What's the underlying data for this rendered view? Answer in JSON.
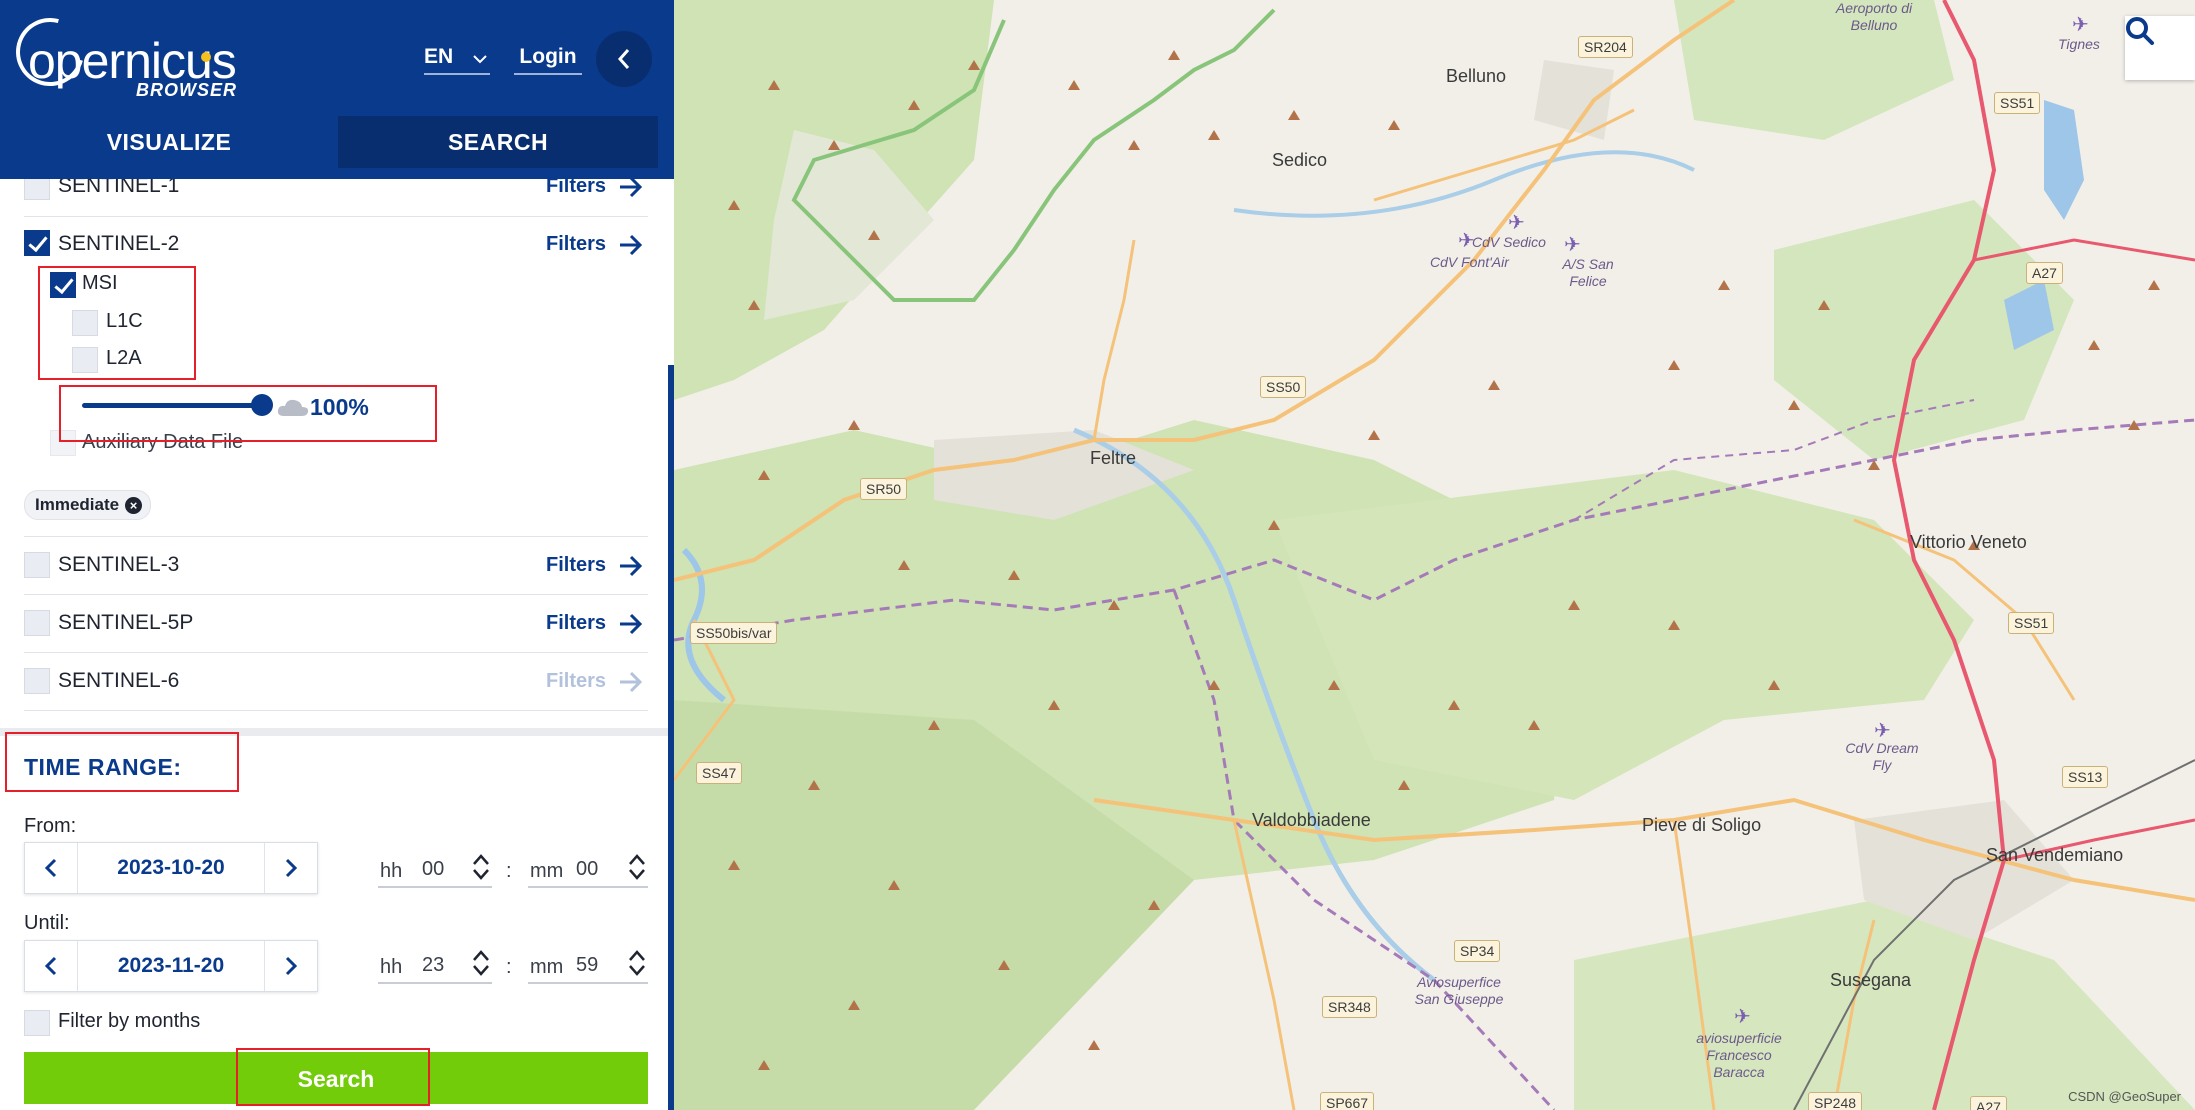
{
  "header": {
    "logo_text": "opernicus",
    "logo_subtext": "BROWSER",
    "language": "EN",
    "login_label": "Login",
    "tabs": [
      "VISUALIZE",
      "SEARCH"
    ],
    "active_tab": "SEARCH"
  },
  "datasets": {
    "filters_label": "Filters",
    "items": [
      {
        "name": "SENTINEL-1",
        "checked": false
      },
      {
        "name": "SENTINEL-2",
        "checked": true
      },
      {
        "name": "SENTINEL-3",
        "checked": false
      },
      {
        "name": "SENTINEL-5P",
        "checked": false
      },
      {
        "name": "SENTINEL-6",
        "checked": false,
        "filters_disabled": true
      }
    ],
    "sentinel2_sub": {
      "instrument": {
        "name": "MSI",
        "checked": true
      },
      "levels": [
        {
          "name": "L1C",
          "checked": false
        },
        {
          "name": "L2A",
          "checked": false
        }
      ],
      "cloud_cover": "100%",
      "cloud_cover_fraction": 1.0,
      "auxiliary_label": "Auxiliary Data File"
    },
    "timeliness_tag": "Immediate"
  },
  "time_range": {
    "title": "TIME RANGE:",
    "from_label": "From:",
    "from_date": "2023-10-20",
    "from_hh": "00",
    "from_mm": "00",
    "until_label": "Until:",
    "until_date": "2023-11-20",
    "until_hh": "23",
    "until_mm": "59",
    "hh_label": "hh",
    "mm_label": "mm",
    "colon": ":",
    "filter_by_months_label": "Filter by months",
    "search_button_label": "Search"
  },
  "map": {
    "towns": [
      "Belluno",
      "Sedico",
      "Feltre",
      "Vittorio Veneto",
      "Valdobbiadene",
      "Pieve di Soligo",
      "San Vendemiano",
      "Susegana"
    ],
    "airfields": [
      "Aeroporto di Belluno",
      "Tignes",
      "CdV Sedico",
      "CdV Font'Air",
      "A/S San Felice",
      "CdV Dream Fly",
      "Aviosuperfice San Giuseppe",
      "aviosuperficie Francesco Baracca"
    ],
    "roads": [
      "SR204",
      "SS51",
      "A27",
      "SS50",
      "SR50",
      "SS50bis/var",
      "SS47",
      "SS51",
      "SS13",
      "SP34",
      "SR348",
      "SP667",
      "SP248",
      "A27"
    ],
    "watermark": "CSDN @GeoSuper",
    "colors": {
      "forest": "#cfe3b4",
      "urban": "#e6e4de",
      "motorway": "#e8586e",
      "primary": "#f5c27a",
      "water": "#9ec6e8"
    }
  }
}
